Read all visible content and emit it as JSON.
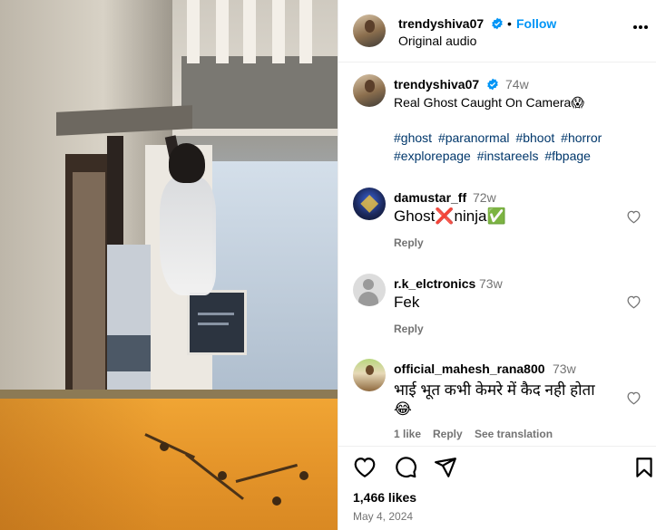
{
  "post": {
    "username": "trendyshiva07",
    "follow_label": "Follow",
    "dot": "•",
    "audio": "Original audio",
    "caption_time": "74w",
    "caption": "Real Ghost Caught On Camera😱",
    "hashtags": [
      "#ghost",
      "#paranormal",
      "#bhoot",
      "#horror",
      "#explorepage",
      "#instareels",
      "#fbpage"
    ]
  },
  "comments": [
    {
      "user": "damustar_ff",
      "time": "72w",
      "text": "Ghost❌ninja✅",
      "reply": "Reply"
    },
    {
      "user": "r.k_elctronics",
      "time": "73w",
      "text": "Fek",
      "reply": "Reply"
    },
    {
      "user": "official_mahesh_rana800",
      "time": "73w",
      "text": "भाई भूत कभी केमरे में कैद नही होता",
      "text2": "😂",
      "likes": "1 like",
      "reply": "Reply",
      "translate": "See translation"
    }
  ],
  "footer": {
    "likes": "1,466 likes",
    "date": "May 4, 2024"
  },
  "icons": [
    "heart-icon",
    "comment-icon",
    "share-icon",
    "bookmark-icon",
    "verified-icon",
    "more-icon"
  ],
  "colors": {
    "link": "#0095f6",
    "hashtag": "#00376b",
    "muted": "#737373",
    "verified": "#0095f6"
  }
}
